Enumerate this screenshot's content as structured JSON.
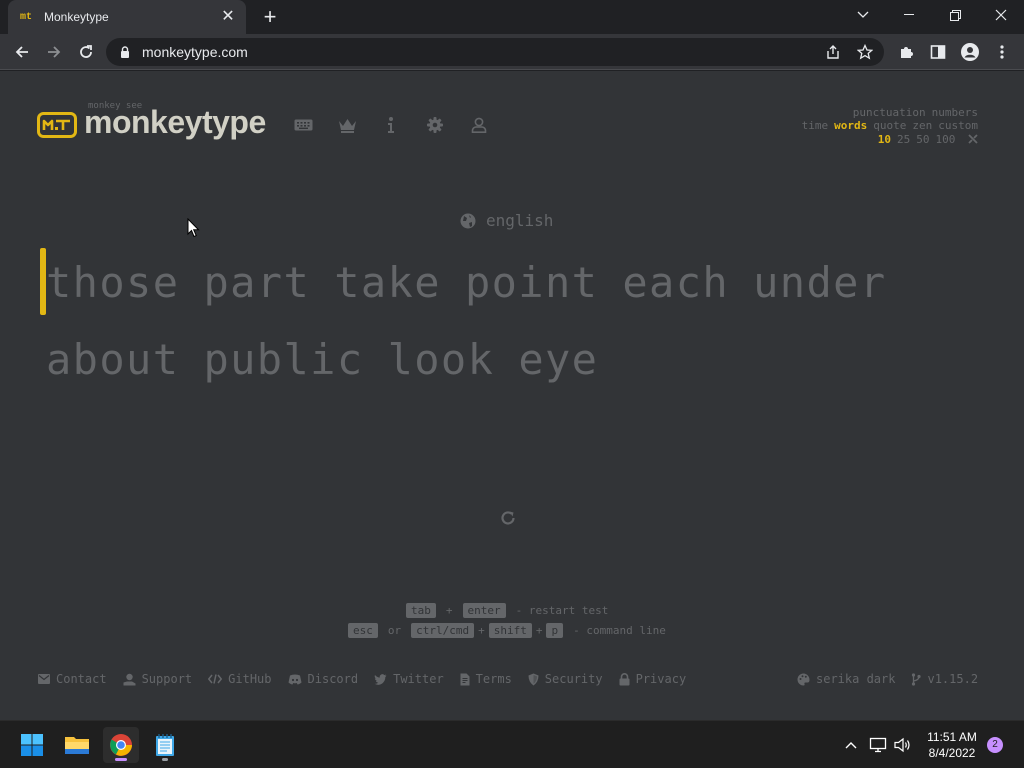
{
  "browser": {
    "tab_title": "Monkeytype",
    "favicon_text": "mt",
    "url": "monkeytype.com"
  },
  "header": {
    "logo_top": "monkey see",
    "logo_text": "monkeytype",
    "nav_icons": [
      "keyboard-icon",
      "crown-icon",
      "info-icon",
      "gear-icon",
      "user-icon"
    ]
  },
  "config": {
    "row1": [
      "punctuation",
      "numbers"
    ],
    "row2": [
      "time",
      "words",
      "quote",
      "zen",
      "custom"
    ],
    "row2_active": "words",
    "row3": [
      "10",
      "25",
      "50",
      "100"
    ],
    "row3_active": "10"
  },
  "test": {
    "language": "english",
    "line1": [
      "those",
      "part",
      "take",
      "point",
      "each",
      "under"
    ],
    "line2": [
      "about",
      "public",
      "look",
      "eye"
    ]
  },
  "hints": {
    "key_tab": "tab",
    "plus": "+",
    "key_enter": "enter",
    "restart_text": "- restart test",
    "key_esc": "esc",
    "or_text": "or",
    "key_ctrlcmd": "ctrl/cmd",
    "key_shift": "shift",
    "key_p": "p",
    "command_text": "- command line"
  },
  "footer": {
    "links": [
      "Contact",
      "Support",
      "GitHub",
      "Discord",
      "Twitter",
      "Terms",
      "Security",
      "Privacy"
    ],
    "theme": "serika dark",
    "version": "v1.15.2"
  },
  "taskbar": {
    "time": "11:51 AM",
    "date": "8/4/2022",
    "notifications": "2"
  },
  "colors": {
    "bg": "#323437",
    "main": "#e2b714",
    "sub": "#646669",
    "text": "#d1d0c5"
  }
}
